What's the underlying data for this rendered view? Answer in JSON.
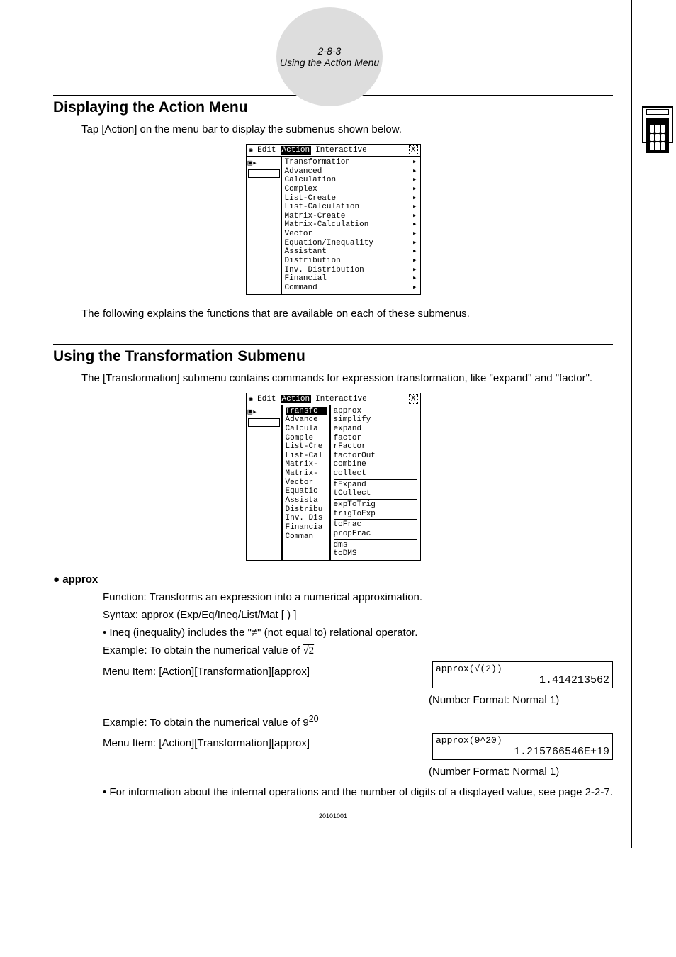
{
  "header": {
    "page_ref": "2-8-3",
    "title": "Using the Action Menu"
  },
  "sec1": {
    "heading": "Displaying the Action Menu",
    "intro": "Tap [Action] on the menu bar to display the submenus shown below.",
    "after": "The following explains the functions that are available on each of these submenus."
  },
  "menubar": {
    "m1": "Edit",
    "m2": "Action",
    "m3": "Interactive",
    "close": "X"
  },
  "action_menu": [
    "Transformation",
    "Advanced",
    "Calculation",
    "Complex",
    "List-Create",
    "List-Calculation",
    "Matrix-Create",
    "Matrix-Calculation",
    "Vector",
    "Equation/Inequality",
    "Assistant",
    "Distribution",
    "Inv. Distribution",
    "Financial",
    "Command"
  ],
  "sec2": {
    "heading": "Using the Transformation Submenu",
    "intro": "The [Transformation] submenu contains commands for expression transformation, like \"expand\" and \"factor\"."
  },
  "action_menu_trunc": [
    "Transfo",
    "Advance",
    "Calcula",
    "Comple",
    "List-Cre",
    "List-Cal",
    "Matrix-",
    "Matrix-",
    "Vector",
    "Equatio",
    "Assista",
    "Distribu",
    "Inv. Dis",
    "Financia",
    "Comman"
  ],
  "trans_submenu": {
    "g1": [
      "approx",
      "simplify",
      "expand",
      "factor",
      "rFactor",
      "factorOut",
      "combine",
      "collect"
    ],
    "g2": [
      "tExpand",
      "tCollect"
    ],
    "g3": [
      "expToTrig",
      "trigToExp"
    ],
    "g4": [
      "toFrac",
      "propFrac"
    ],
    "g5": [
      "dms",
      "toDMS"
    ]
  },
  "approx": {
    "title": "approx",
    "func": "Function: Transforms an expression into a numerical approximation.",
    "syntax": "Syntax: approx (Exp/Eq/Ineq/List/Mat [ ) ]",
    "ineq_note": "Ineq (inequality) includes the \"≠\" (not equal to) relational operator.",
    "ex1_label_a": "Example: To obtain the numerical value of ",
    "ex1_label_b": "√2",
    "menu_item": "Menu Item: [Action][Transformation][approx]",
    "out1_cmd": "approx(√(2))",
    "out1_res": "1.414213562",
    "nf": "(Number Format: Normal 1)",
    "ex2_label_a": "Example: To obtain the numerical value of 9",
    "ex2_exp": "20",
    "out2_cmd": "approx(9^20)",
    "out2_res": "1.215766546E+19",
    "footnote": "For information about the internal operations and the number of digits of a displayed value, see page 2-2-7."
  },
  "footer": "20101001"
}
